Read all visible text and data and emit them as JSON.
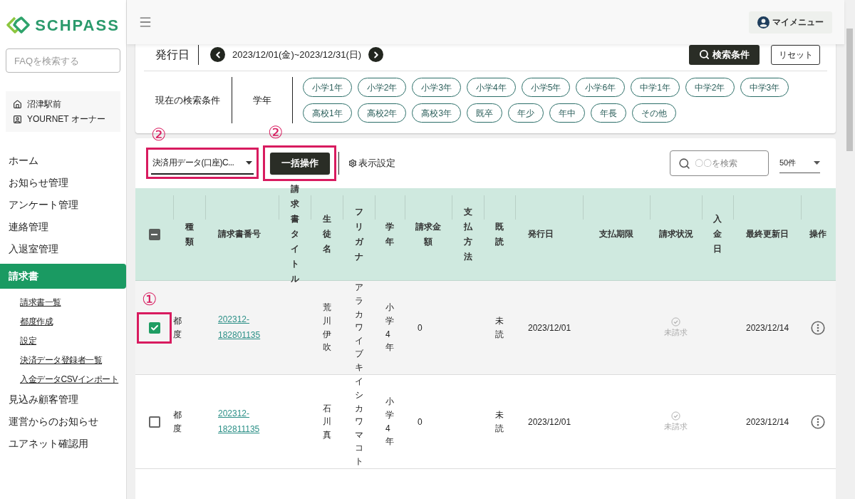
{
  "logo": {
    "text": "SCHPASS"
  },
  "sidebar": {
    "faq_search": {
      "placeholder": "FAQを検索する"
    },
    "account": {
      "school": "沼津駅前",
      "role": "YOURNET オーナー"
    },
    "nav": [
      {
        "label": "ホーム",
        "selected": false
      },
      {
        "label": "お知らせ管理",
        "selected": false
      },
      {
        "label": "アンケート管理",
        "selected": false
      },
      {
        "label": "連絡管理",
        "selected": false
      },
      {
        "label": "入退室管理",
        "selected": false
      },
      {
        "label": "請求書",
        "selected": true,
        "children": [
          {
            "label": "請求書一覧"
          },
          {
            "label": "都度作成"
          },
          {
            "label": "設定"
          },
          {
            "label": "決済データ登録者一覧"
          },
          {
            "label": "入金データCSVインポート"
          }
        ]
      },
      {
        "label": "見込み顧客管理",
        "selected": false
      },
      {
        "label": "運営からのお知らせ",
        "selected": false
      },
      {
        "label": "ユアネット確認用",
        "selected": false
      }
    ]
  },
  "header": {
    "my_menu": "マイメニュー"
  },
  "filter": {
    "date_label": "発行日",
    "date_range": "2023/12/01(金)~2023/12/31(日)",
    "search_button": "検索条件",
    "reset_button": "リセット",
    "current_label": "現在の検索条件",
    "grade_label": "学年",
    "grades": [
      "小学1年",
      "小学2年",
      "小学3年",
      "小学4年",
      "小学5年",
      "小学6年",
      "中学1年",
      "中学2年",
      "中学3年",
      "高校1年",
      "高校2年",
      "高校3年",
      "既卒",
      "年少",
      "年中",
      "年長",
      "その他"
    ]
  },
  "toolbar": {
    "export_select": {
      "value": "決済用データ(口座)C...",
      "annotation": "②"
    },
    "bulk_button": {
      "label": "一括操作",
      "annotation": "②"
    },
    "display_settings": "表示設定",
    "search": {
      "placeholder": "〇〇を検索"
    },
    "per_page": {
      "value": "50件"
    }
  },
  "table": {
    "select_all": {
      "indeterminate": true
    },
    "columns": [
      "種類",
      "請求書番号",
      "請求書タイトル",
      "生徒名",
      "フリガナ",
      "学年",
      "請求金額",
      "支払方法",
      "既読",
      "発行日",
      "支払期限",
      "請求状況",
      "入金日",
      "最終更新日",
      "操作"
    ],
    "rows": [
      {
        "checked": true,
        "annotation": "①",
        "type": "都度",
        "number": "202312-182801135",
        "name": "荒川伊吹",
        "kana": "アラカワイブキ",
        "grade": "小学4年",
        "amount": "0",
        "read": "未読",
        "issue_date": "2023/12/01",
        "status": "未請求",
        "updated": "2023/12/14"
      },
      {
        "checked": false,
        "type": "都度",
        "number": "202312-182811135",
        "name": "石川真",
        "kana": "イシカワマコト",
        "grade": "小学4年",
        "amount": "0",
        "read": "未読",
        "issue_date": "2023/12/01",
        "status": "未請求",
        "updated": "2023/12/14"
      }
    ]
  }
}
